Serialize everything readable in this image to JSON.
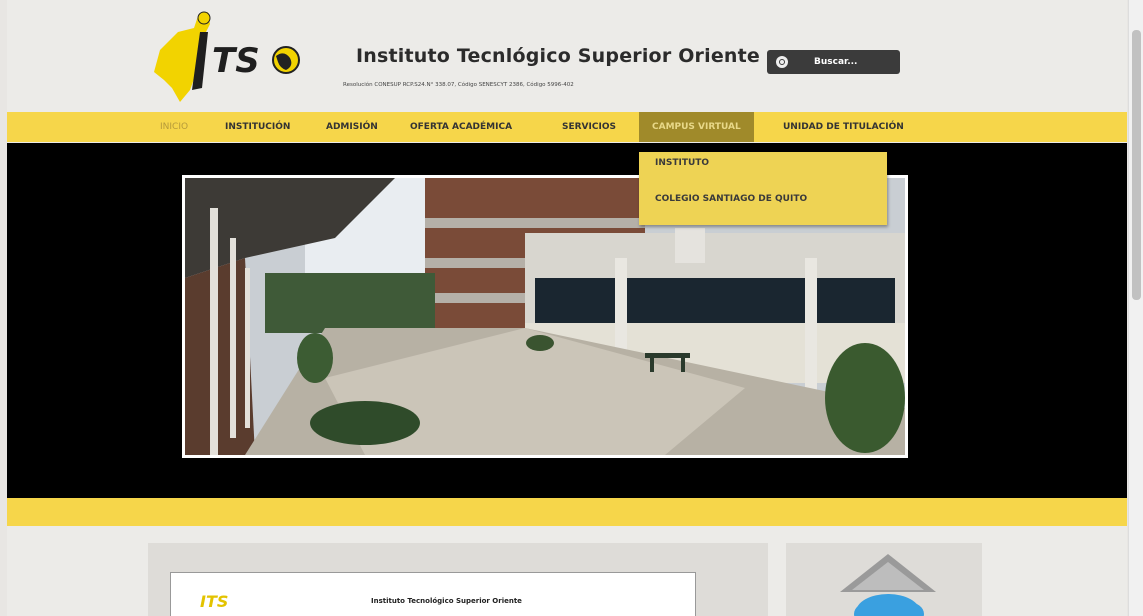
{
  "header": {
    "title": "Instituto Tecnlógico Superior Oriente",
    "subtitle": "Resolución CONESUP RCP.S24.N° 338.07, Código SENESCYT 2386, Código 5996-402",
    "logo_text": "ITS"
  },
  "search": {
    "placeholder": "Buscar..."
  },
  "nav": {
    "items": [
      {
        "label": "INICIO"
      },
      {
        "label": "INSTITUCIÓN"
      },
      {
        "label": "ADMISIÓN"
      },
      {
        "label": "OFERTA ACADÉMICA"
      },
      {
        "label": "SERVICIOS"
      },
      {
        "label": "CAMPUS VIRTUAL"
      },
      {
        "label": "UNIDAD DE TITULACIÓN"
      }
    ],
    "active_index": 5
  },
  "dropdown": {
    "items": [
      {
        "label": "INSTITUTO"
      },
      {
        "label": "COLEGIO SANTIAGO DE QUITO"
      }
    ]
  },
  "content": {
    "doc_logo": "ITS",
    "doc_title": "Instituto Tecnológico Superior Oriente"
  },
  "colors": {
    "brand_yellow": "#f6d64a",
    "active_nav": "#a08a2a",
    "hero_bg": "#000000",
    "search_bg": "#3b3b3b"
  },
  "icons": [
    "search-icon",
    "cloud-icon",
    "logo-globe-icon"
  ]
}
